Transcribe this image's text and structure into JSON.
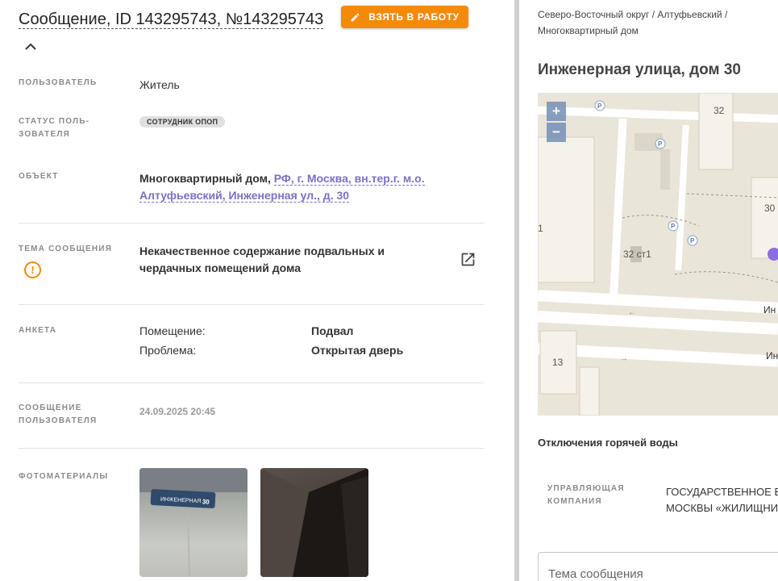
{
  "header": {
    "title": "Сообщение, ID 143295743, №143295743",
    "take_button": "ВЗЯТЬ В РАБОТУ"
  },
  "fields": {
    "user_label": "ПОЛЬЗОВАТЕЛЬ",
    "user_value": "Житель",
    "status_label": "СТАТУС ПОЛЬ- ЗОВАТЕЛЯ",
    "status_badge": "СОТРУДНИК ОПОП",
    "object_label": "ОБЪЕКТ",
    "object_type": "Многоквартирный дом,",
    "object_address": "РФ, г. Москва, вн.тер.г. м.о. Алтуфьевский, Инженерная ул., д. 30",
    "theme_label": "ТЕМА СООБЩЕНИЯ",
    "theme_value": "Некачественное содержание подвальных и чердачных помещений дома",
    "form_label": "АНКЕТА",
    "form_rows": [
      {
        "key": "Помещение:",
        "value": "Подвал"
      },
      {
        "key": "Проблема:",
        "value": "Открытая дверь"
      }
    ],
    "message_label": "СООБЩЕНИЕ ПОЛЬЗОВАТЕЛЯ",
    "message_date": "24.09.2025 20:45",
    "photos_label": "ФОТОМАТЕРИАЛЫ"
  },
  "photo1_plate_text": "ИНЖЕНЕРНАЯ 30",
  "right": {
    "breadcrumb": "Северо-Восточный округ / Алтуфьевский / Многоквартирный дом",
    "address": "Инженерная улица, дом 30",
    "map": {
      "zoom_in": "+",
      "zoom_out": "−",
      "labels": [
        "32",
        "30",
        "32 ст1",
        "13",
        "1",
        "Ин",
        "Ин"
      ]
    },
    "outage_title": "Отключения горячей воды",
    "mc_label": "УПРАВЛЯЮЩАЯ КОМПАНИЯ",
    "mc_value_line1": "ГОСУДАРСТВЕННОЕ Б",
    "mc_value_line2": "МОСКВЫ «ЖИЛИЩНИ",
    "theme_placeholder": "Тема сообщения"
  },
  "colors": {
    "accent": "#f58a0a",
    "link": "#7b6fc4",
    "map_bg": "#eae5d9"
  }
}
